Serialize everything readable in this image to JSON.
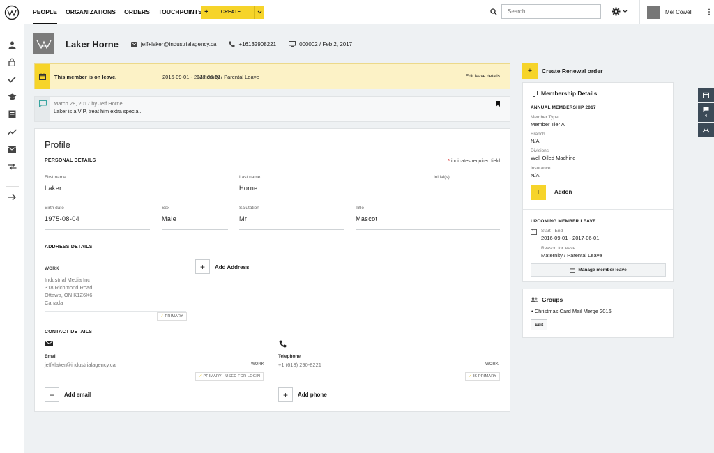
{
  "topnav": {
    "items": [
      "PEOPLE",
      "ORGANIZATIONS",
      "ORDERS",
      "TOUCHPOINTS"
    ],
    "create_label": "CREATE",
    "search_placeholder": "Search",
    "user_name": "Mel Cowell"
  },
  "member": {
    "name": "Laker Horne",
    "email": "jeff+laker@industrialagency.ca",
    "phone": "+16132908221",
    "member_id": "000002 / Feb 2, 2017"
  },
  "leave_banner": {
    "title": "This member is on leave.",
    "dates": "2016-09-01 - 2017-06-01",
    "reason": "Maternity / Parental Leave",
    "edit_link": "Edit leave details"
  },
  "note": {
    "meta": "March 28, 2017 by Jeff Horne",
    "text": "Laker is a VIP, treat him extra special."
  },
  "profile": {
    "heading": "Profile",
    "personal_title": "PERSONAL DETAILS",
    "required_note": "indicates required field",
    "fields": [
      {
        "label": "First name",
        "value": "Laker"
      },
      {
        "label": "Last name",
        "value": "Horne"
      },
      {
        "label": "Initial(s)",
        "value": ""
      },
      {
        "label": "Birth date",
        "value": "1975-08-04"
      },
      {
        "label": "Sex",
        "value": "Male"
      },
      {
        "label": "Salutation",
        "value": "Mr"
      },
      {
        "label": "Title",
        "value": "Mascot"
      }
    ],
    "address_title": "ADDRESS DETAILS",
    "address": {
      "label": "WORK",
      "lines": [
        "Industrial Media Inc",
        "318 Richmond Road",
        "Ottawa, ON K1Z6X6",
        "Canada"
      ],
      "tag": "PRIMARY"
    },
    "add_address": "Add Address",
    "contact_title": "CONTACT DETAILS",
    "email": {
      "label": "Email",
      "value": "jeff+laker@industrialagency.ca",
      "type": "WORK",
      "tag": "PRIMARY - USED FOR LOGIN",
      "add": "Add email"
    },
    "phone": {
      "label": "Telephone",
      "value": "+1 (613) 290-8221",
      "type": "WORK",
      "tag": "IS PRIMARY",
      "add": "Add phone"
    }
  },
  "renewal": {
    "label": "Create Renewal order"
  },
  "membership": {
    "title": "Membership Details",
    "annual": "ANNUAL MEMBERSHIP 2017",
    "rows": [
      {
        "label": "Member Type",
        "value": "Member Tier A"
      },
      {
        "label": "Branch",
        "value": "N/A"
      },
      {
        "label": "Divisions",
        "value": "Well Oiled Machine"
      },
      {
        "label": "Insurance",
        "value": "N/A"
      }
    ],
    "addon": "Addon",
    "upcoming_title": "UPCOMING MEMBER LEAVE",
    "start_end_label": "Start - End",
    "start_end_value": "2016-09-01 - 2017-06-01",
    "reason_label": "Reason for leave",
    "reason_value": "Maternity / Parental Leave",
    "manage_label": "Manage member leave"
  },
  "groups": {
    "title": "Groups",
    "items": [
      "Christmas Card Mail Merge 2016"
    ],
    "edit": "Edit"
  },
  "right_tabs": {
    "comments_count": "4"
  },
  "colors": {
    "accent": "#f6d42a",
    "banner": "#fcf2c6",
    "sidebar_tab": "#3c4a57"
  }
}
